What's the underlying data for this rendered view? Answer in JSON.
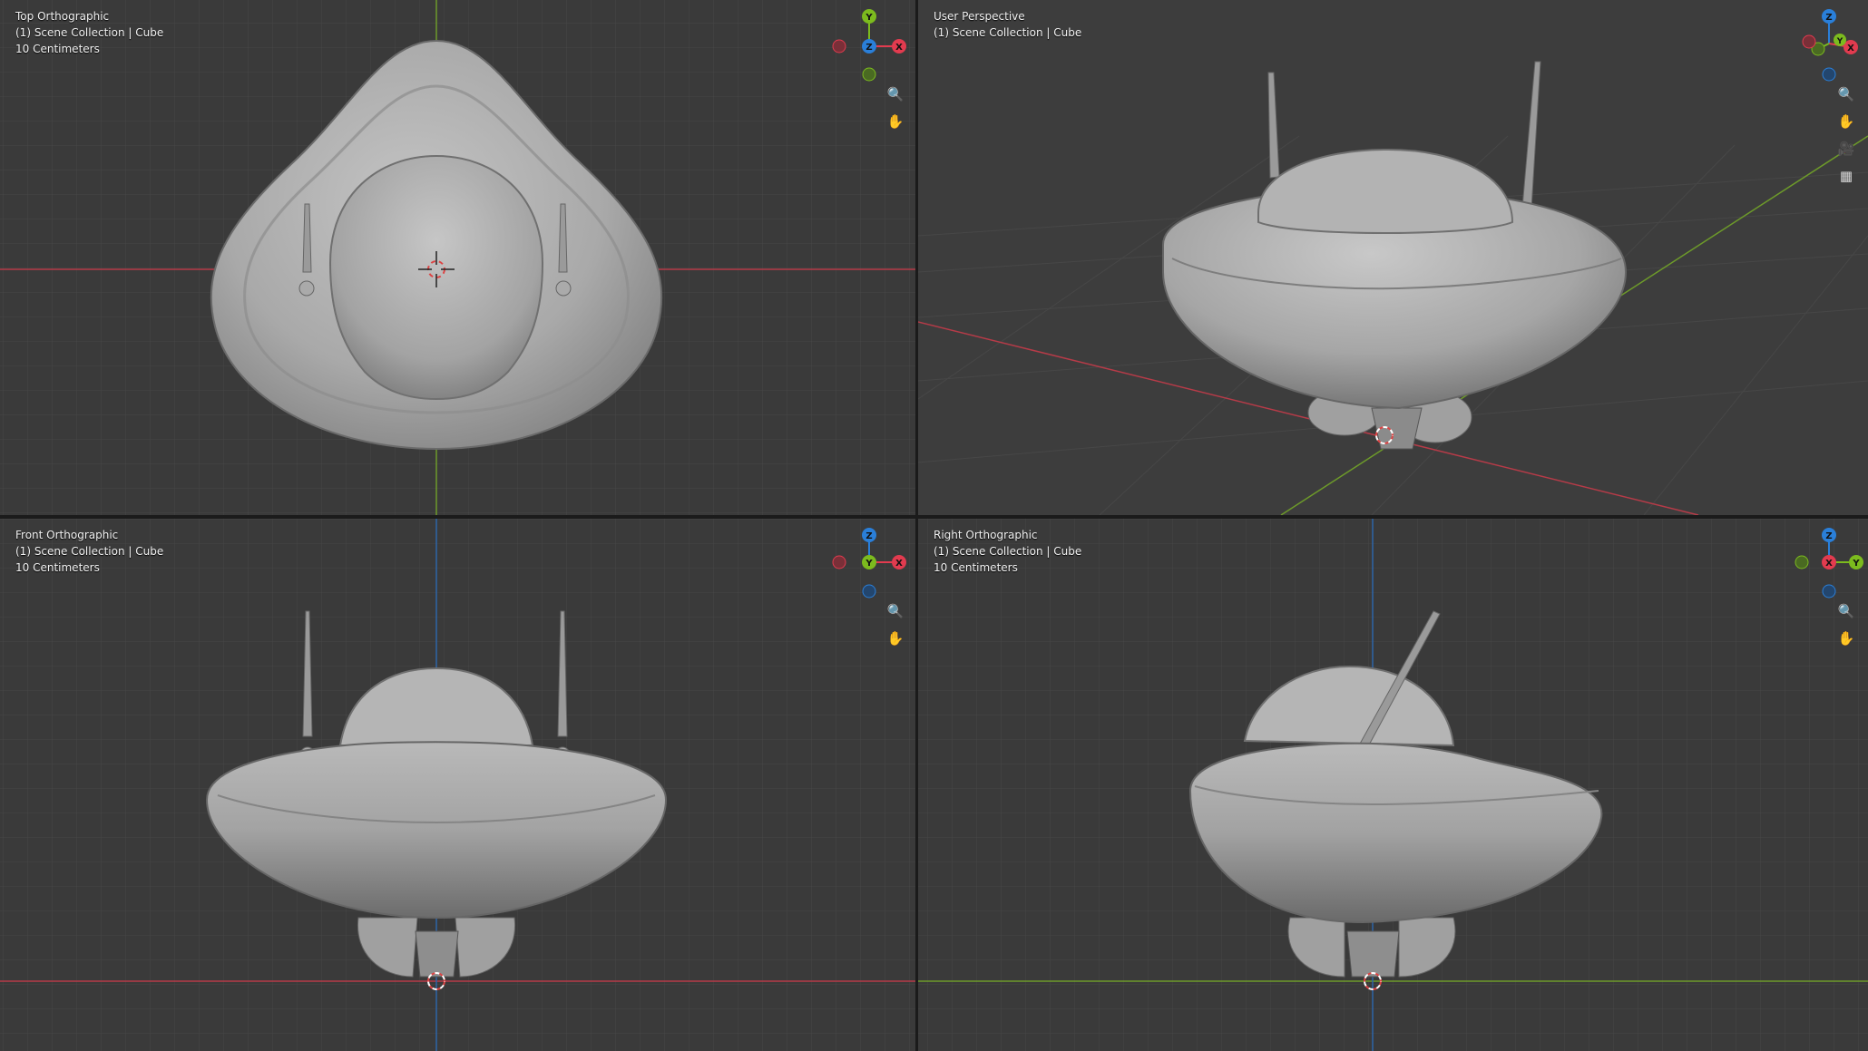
{
  "viewports": {
    "top": {
      "lines": [
        "Top Orthographic",
        "(1) Scene Collection | Cube",
        "10 Centimeters"
      ]
    },
    "persp": {
      "lines": [
        "User Perspective",
        "(1) Scene Collection | Cube"
      ]
    },
    "front": {
      "lines": [
        "Front Orthographic",
        "(1) Scene Collection | Cube",
        "10 Centimeters"
      ]
    },
    "right": {
      "lines": [
        "Right Orthographic",
        "(1) Scene Collection | Cube",
        "10 Centimeters"
      ]
    }
  },
  "gizmo_labels": {
    "x": "X",
    "y": "Y",
    "z": "Z"
  },
  "icons": {
    "zoom": "zoom-magnifier-icon",
    "pan": "hand-pan-icon",
    "camera": "camera-view-icon",
    "ortho": "perspective-ortho-grid-icon"
  },
  "colors": {
    "viewport_bg": "#3a3a3a",
    "grid_line": "#474747",
    "x_axis": "#e23b4f",
    "y_axis": "#7cbb1e",
    "z_axis": "#2a7fd9",
    "model": "#a8a8a8"
  }
}
